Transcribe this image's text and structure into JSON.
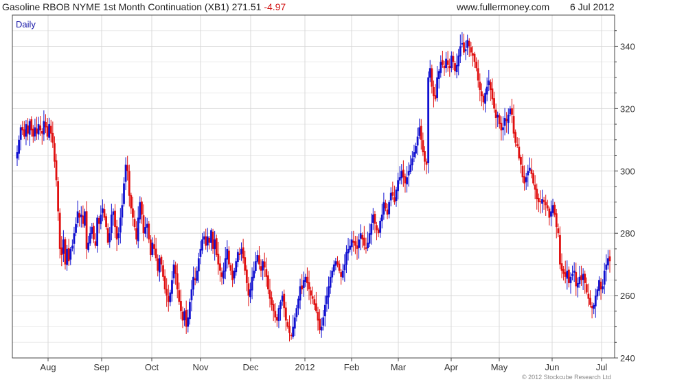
{
  "header": {
    "title": "Gasoline RBOB NYME 1st Month Continuation (XB1)",
    "last": "271.51",
    "change": "-4.97",
    "website": "www.fullermoney.com",
    "date": "6 Jul 2012"
  },
  "footer": {
    "copyright": "© 2012 Stockcube Research Ltd"
  },
  "colors": {
    "up": "#1010d0",
    "down": "#e01010",
    "grid": "#d8d8d8",
    "axis": "#444444",
    "period_label": "#1a1aa8"
  },
  "chart_data": {
    "type": "candlestick",
    "title": "Gasoline RBOB NYME 1st Month Continuation (XB1)",
    "period_label": "Daily",
    "ylim": [
      240,
      350
    ],
    "y_ticks": [
      240,
      260,
      280,
      300,
      320,
      340
    ],
    "x_ticks": [
      "Aug",
      "Sep",
      "Oct",
      "Nov",
      "Dec",
      "2012",
      "Feb",
      "Mar",
      "Apr",
      "May",
      "Jun",
      "Jul"
    ],
    "grid": true,
    "y_axis_side": "right",
    "closes": [
      306,
      310,
      314,
      313,
      311,
      315,
      312,
      316,
      313,
      311,
      314,
      312,
      315,
      313,
      312,
      316,
      314,
      311,
      315,
      312,
      309,
      303,
      297,
      287,
      275,
      273,
      278,
      270,
      275,
      271,
      275,
      276,
      280,
      283,
      287,
      285,
      286,
      283,
      287,
      275,
      277,
      280,
      282,
      278,
      276,
      285,
      283,
      286,
      288,
      285,
      282,
      277,
      280,
      286,
      287,
      282,
      278,
      280,
      285,
      289,
      296,
      302,
      300,
      292,
      288,
      285,
      282,
      278,
      285,
      290,
      286,
      280,
      282,
      283,
      278,
      273,
      277,
      275,
      272,
      268,
      272,
      270,
      266,
      262,
      260,
      258,
      261,
      265,
      270,
      267,
      262,
      258,
      255,
      252,
      255,
      250,
      253,
      258,
      262,
      266,
      265,
      268,
      272,
      275,
      278,
      279,
      276,
      279,
      277,
      281,
      275,
      278,
      273,
      270,
      268,
      266,
      268,
      272,
      275,
      270,
      268,
      265,
      268,
      271,
      274,
      273,
      275,
      272,
      268,
      264,
      260,
      262,
      266,
      268,
      271,
      273,
      270,
      268,
      271,
      269,
      266,
      262,
      259,
      257,
      255,
      253,
      252,
      256,
      258,
      260,
      256,
      252,
      250,
      248,
      247,
      250,
      253,
      256,
      259,
      263,
      262,
      265,
      266,
      264,
      262,
      260,
      259,
      257,
      255,
      252,
      249,
      250,
      253,
      257,
      260,
      263,
      266,
      268,
      270,
      271,
      270,
      268,
      266,
      268,
      270,
      274,
      275,
      276,
      278,
      277,
      276,
      275,
      278,
      280,
      278,
      276,
      275,
      277,
      280,
      283,
      286,
      283,
      281,
      280,
      284,
      286,
      290,
      288,
      286,
      290,
      293,
      292,
      290,
      294,
      297,
      298,
      300,
      298,
      296,
      298,
      300,
      302,
      304,
      306,
      308,
      311,
      314,
      310,
      306,
      303,
      302,
      330,
      333,
      327,
      324,
      323,
      330,
      332,
      335,
      334,
      333,
      336,
      334,
      333,
      337,
      335,
      332,
      334,
      337,
      340,
      341,
      338,
      339,
      342,
      340,
      338,
      337,
      335,
      333,
      329,
      326,
      324,
      322,
      325,
      327,
      329,
      326,
      323,
      320,
      317,
      318,
      315,
      313,
      314,
      317,
      316,
      318,
      320,
      318,
      312,
      309,
      308,
      304,
      302,
      298,
      296,
      298,
      300,
      301,
      299,
      296,
      294,
      291,
      290,
      290,
      291,
      290,
      289,
      288,
      285,
      287,
      289,
      286,
      282,
      280,
      270,
      268,
      267,
      266,
      268,
      264,
      266,
      267,
      268,
      263,
      264,
      266,
      265,
      267,
      264,
      261,
      259,
      257,
      256,
      257,
      260,
      262,
      265,
      262,
      263,
      268,
      270,
      272,
      271
    ]
  }
}
